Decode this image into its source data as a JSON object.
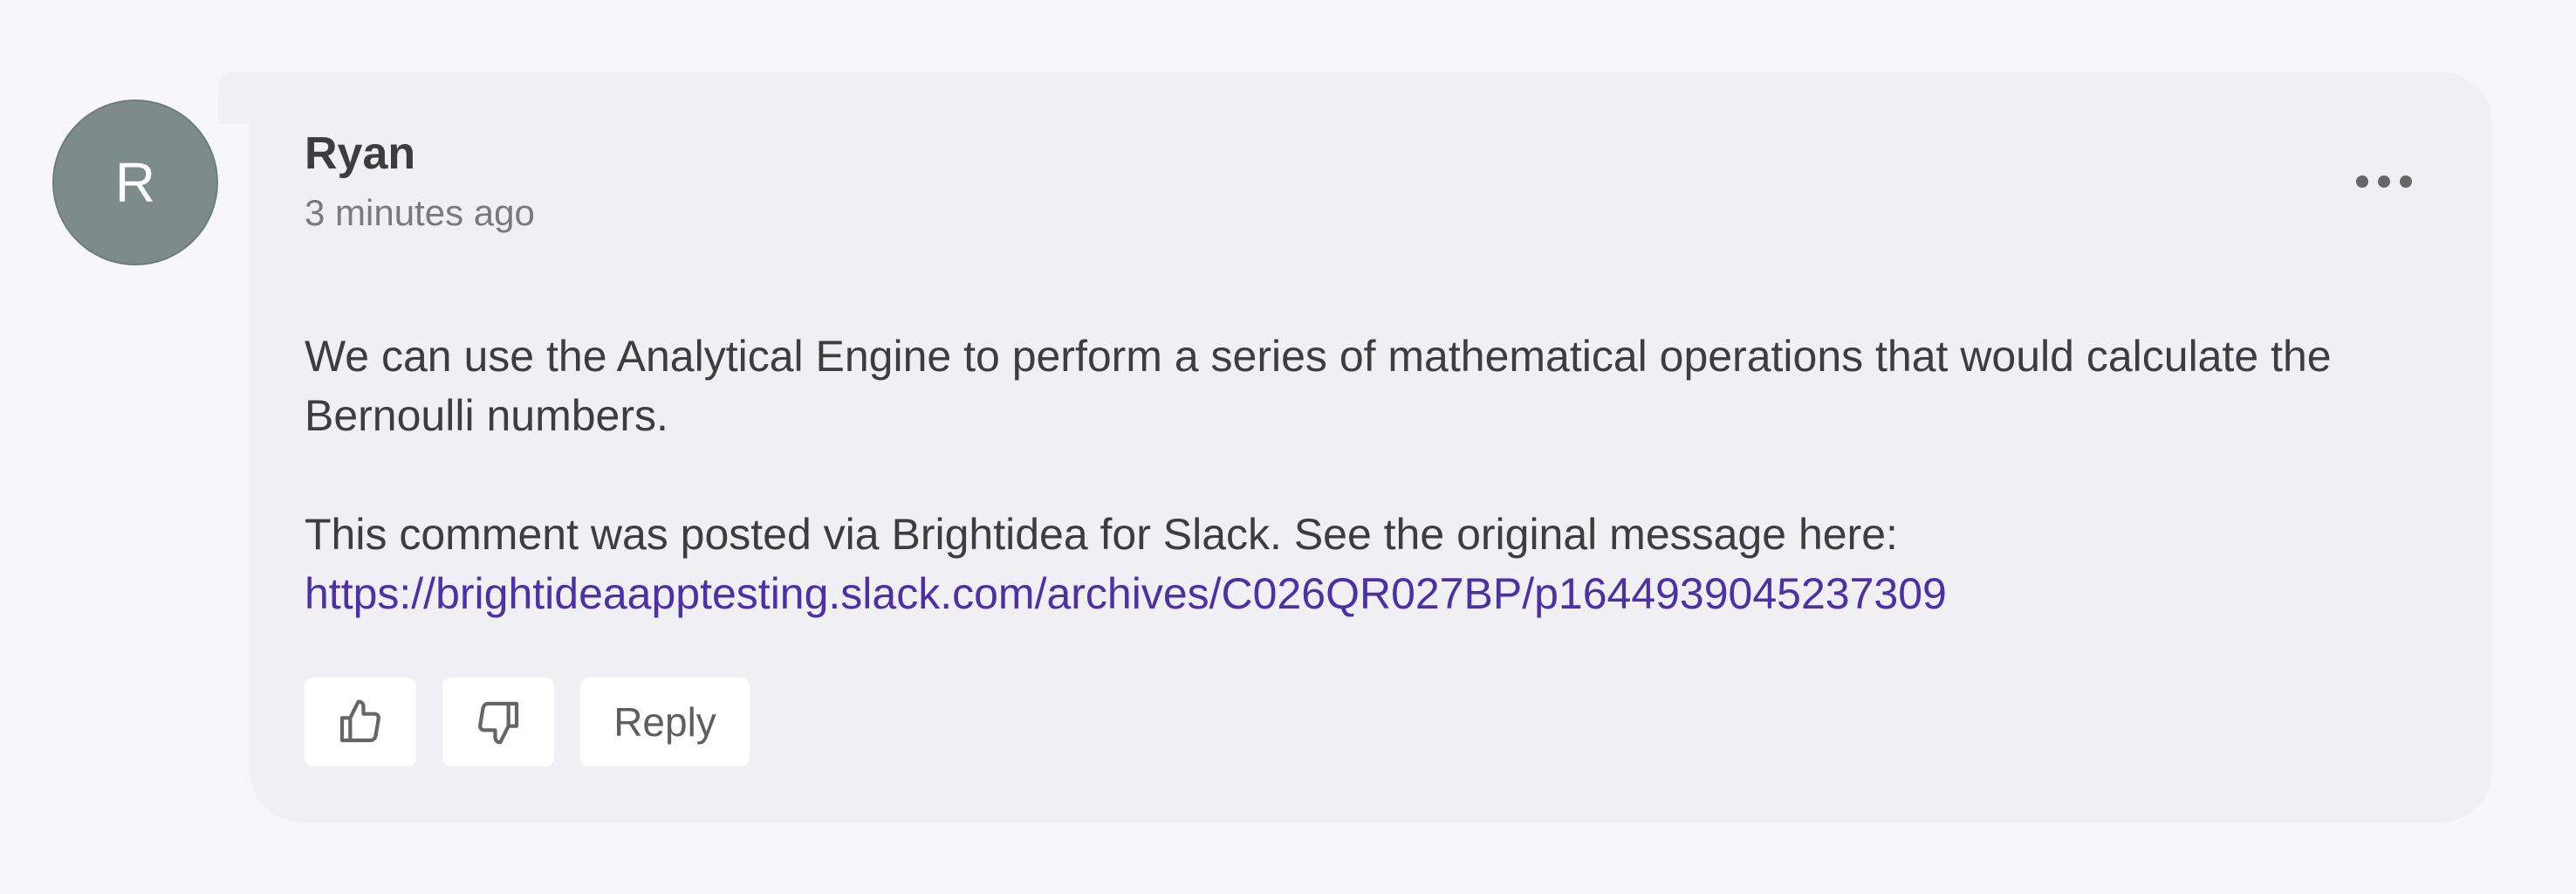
{
  "comment": {
    "avatar_initial": "R",
    "author": "Ryan",
    "timestamp": "3 minutes ago",
    "body_line1": "We can use the Analytical Engine to perform a series of mathematical operations that would calculate the Bernoulli numbers.",
    "body_line2": "This comment was posted via Brightidea for Slack. See the original message here:",
    "link_text": "https://brightideaapptesting.slack.com/archives/C026QR027BP/p1644939045237309",
    "link_href": "https://brightideaapptesting.slack.com/archives/C026QR027BP/p1644939045237309",
    "more_icon": "more-horizontal-icon"
  },
  "actions": {
    "like_icon": "thumbs-up-icon",
    "dislike_icon": "thumbs-down-icon",
    "reply_label": "Reply"
  },
  "colors": {
    "page_bg": "#f5f5fa",
    "card_bg": "#efeff4",
    "avatar_bg": "#7e8b8b",
    "link": "#4b30a6",
    "text": "#3d3d3d"
  }
}
